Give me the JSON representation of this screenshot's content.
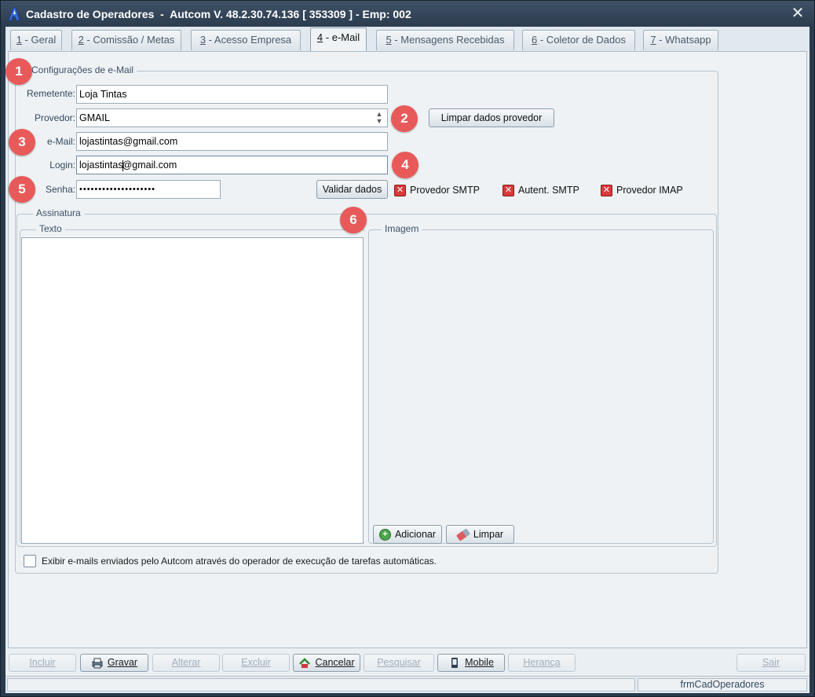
{
  "window": {
    "title": "Cadastro de Operadores  -  Autcom V. 48.2.30.74.136 [ 353309 ] - Emp: 002",
    "close_label": "✕"
  },
  "tabs": [
    {
      "num": "1",
      "label": " - Geral"
    },
    {
      "num": "2",
      "label": " - Comissão / Metas"
    },
    {
      "num": "3",
      "label": " - Acesso Empresa"
    },
    {
      "num": "4",
      "label": " - e-Mail"
    },
    {
      "num": "5",
      "label": " - Mensagens Recebidas"
    },
    {
      "num": "6",
      "label": " - Coletor de Dados"
    },
    {
      "num": "7",
      "label": " - Whatsapp"
    }
  ],
  "email_config": {
    "legend": "Configurações de e-Mail",
    "remetente_label": "Remetente:",
    "remetente_value": "Loja Tintas",
    "provedor_label": "Provedor:",
    "provedor_value": "GMAIL",
    "limpar_provedor_label": "Limpar dados provedor",
    "email_label": "e-Mail:",
    "email_value": "lojastintas@gmail.com",
    "login_label": "Login:",
    "login_value_before": "lojastintas",
    "login_value_after": "@gmail.com",
    "senha_label": "Senha:",
    "senha_value": "••••••••••••••••••••",
    "validar_label": "Validar dados",
    "status_smtp": "Provedor SMTP",
    "status_auth": "Autent. SMTP",
    "status_imap": "Provedor IMAP"
  },
  "signature": {
    "legend": "Assinatura",
    "texto_legend": "Texto",
    "imagem_legend": "Imagem",
    "adicionar_label": "Adicionar",
    "limpar_label": "Limpar"
  },
  "option_label": "Exibir e-mails enviados pelo Autcom através do operador de execução de tarefas automáticas.",
  "badges": [
    "1",
    "2",
    "3",
    "4",
    "5",
    "6"
  ],
  "toolbar": {
    "incluir": "Incluir",
    "gravar": "Gravar",
    "alterar": "Alterar",
    "excluir": "Excluir",
    "cancelar": "Cancelar",
    "pesquisar": "Pesquisar",
    "mobile": "Mobile",
    "heranca": "Herança",
    "sair": "Sair"
  },
  "statusbar": {
    "form_name": "frmCadOperadores"
  },
  "colors": {
    "badge": "#e85a5a",
    "titlebar": "#2c3c4f",
    "status_error": "#d83b3b"
  }
}
